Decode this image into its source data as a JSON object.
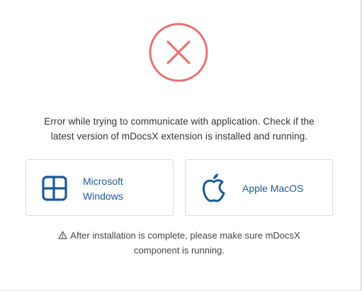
{
  "error_icon": {
    "icon": "error-x-circle-icon",
    "color": "#e57373"
  },
  "message": {
    "line1": "Error while trying to communicate with application. Check if the",
    "line2": "latest version of mDocsX extension is installed and running."
  },
  "options": {
    "windows": {
      "label_line1": "Microsoft",
      "label_line2": "Windows",
      "icon": "windows-logo-icon"
    },
    "mac": {
      "label": "Apple MacOS",
      "icon": "apple-logo-icon"
    }
  },
  "note": {
    "icon": "warning-triangle-icon",
    "line1": "After installation is complete, please make sure mDocsX",
    "line2": "component is running."
  },
  "colors": {
    "accent": "#1a5a96",
    "error": "#e57373",
    "text": "#333333",
    "border": "#dadada"
  }
}
